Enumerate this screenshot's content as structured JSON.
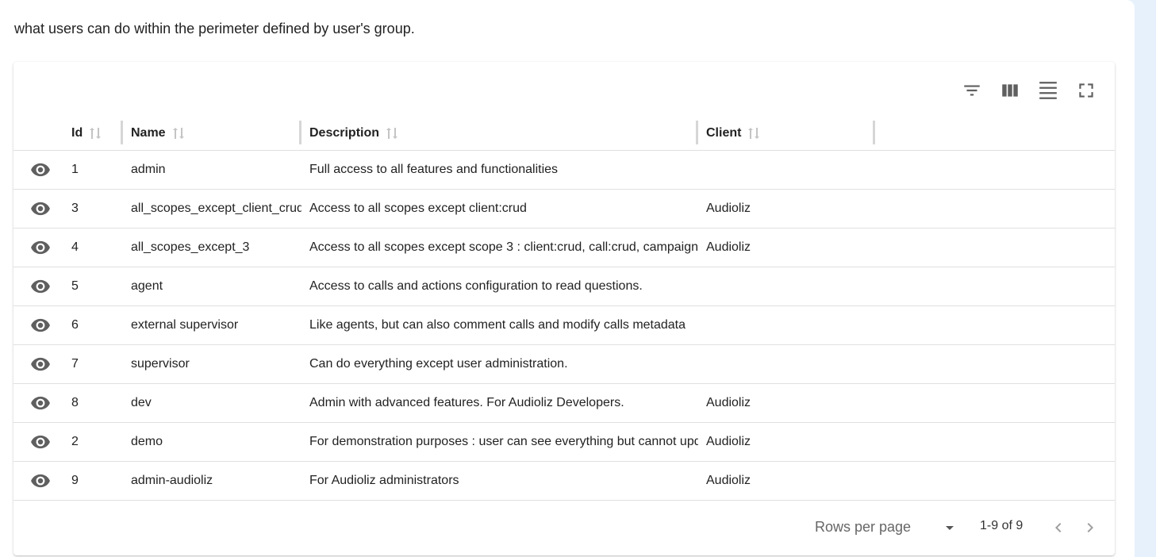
{
  "intro": "what users can do within the perimeter defined by user's group.",
  "toolbar": {
    "icons": [
      "filter-icon",
      "columns-icon",
      "density-icon",
      "fullscreen-icon"
    ]
  },
  "columns": {
    "id": "Id",
    "name": "Name",
    "description": "Description",
    "client": "Client"
  },
  "rows": [
    {
      "id": "1",
      "name": "admin",
      "description": "Full access to all features and functionalities",
      "client": ""
    },
    {
      "id": "3",
      "name": "all_scopes_except_client_crud",
      "description": "Access to all scopes except client:crud",
      "client": "Audioliz"
    },
    {
      "id": "4",
      "name": "all_scopes_except_3",
      "description": "Access to all scopes except scope 3 : client:crud, call:crud, campaign",
      "client": "Audioliz"
    },
    {
      "id": "5",
      "name": "agent",
      "description": "Access to calls and actions configuration to read questions.",
      "client": ""
    },
    {
      "id": "6",
      "name": "external supervisor",
      "description": "Like agents, but can also comment calls and modify calls metadata",
      "client": ""
    },
    {
      "id": "7",
      "name": "supervisor",
      "description": "Can do everything except user administration.",
      "client": ""
    },
    {
      "id": "8",
      "name": "dev",
      "description": "Admin with advanced features. For Audioliz Developers.",
      "client": "Audioliz"
    },
    {
      "id": "2",
      "name": "demo",
      "description": "For demonstration purposes : user can see everything but cannot update",
      "client": "Audioliz"
    },
    {
      "id": "9",
      "name": "admin-audioliz",
      "description": "For Audioliz administrators",
      "client": "Audioliz"
    }
  ],
  "footer": {
    "rows_per_page_label": "Rows per page",
    "page_info": "1-9 of 9"
  },
  "colors": {
    "background": "#e6f1fc",
    "icon": "#5f5f5f",
    "border": "#e0e0e0"
  }
}
